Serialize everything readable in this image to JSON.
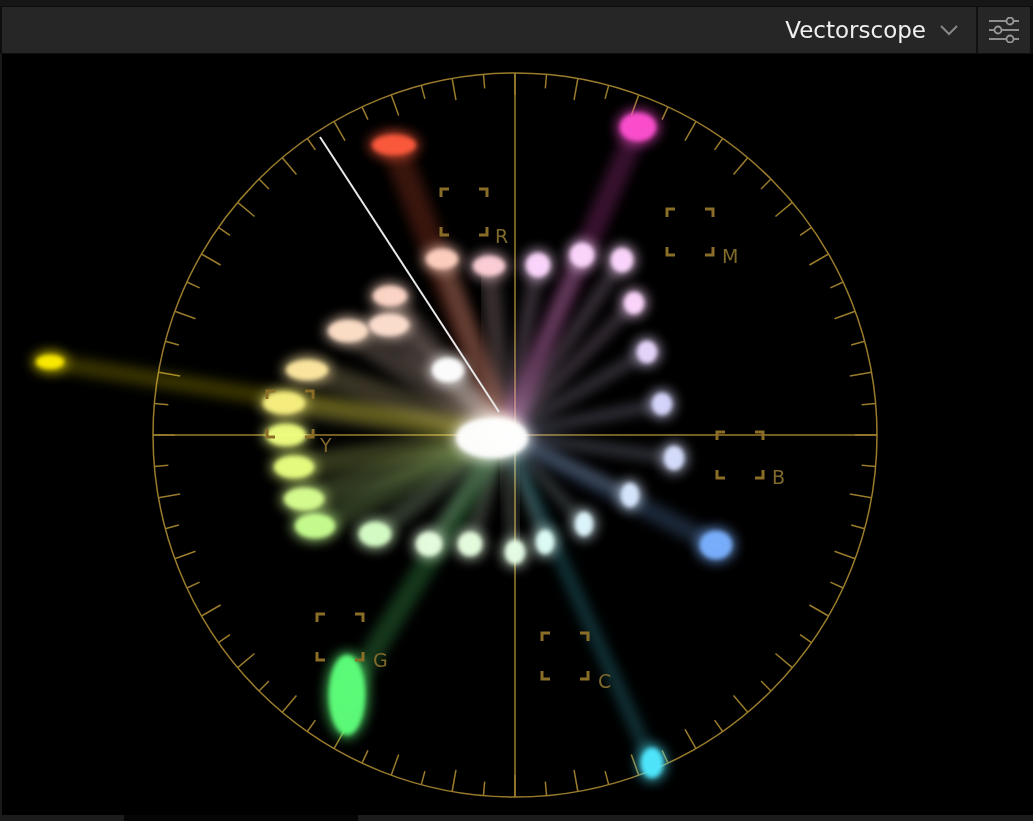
{
  "header": {
    "title": "Vectorscope"
  },
  "targets": [
    {
      "label": "R"
    },
    {
      "label": "M"
    },
    {
      "label": "B"
    },
    {
      "label": "C"
    },
    {
      "label": "G"
    },
    {
      "label": "Y"
    }
  ]
}
